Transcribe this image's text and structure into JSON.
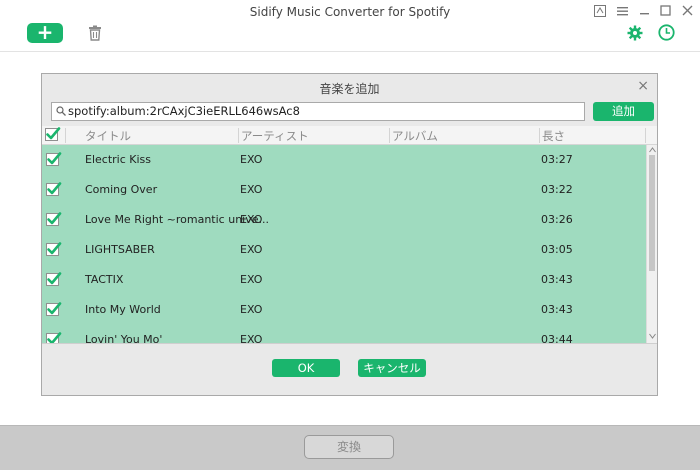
{
  "app": {
    "title": "Sidify Music Converter for Spotify",
    "add_button": "+",
    "convert_label": "変換"
  },
  "dialog": {
    "title": "音楽を追加",
    "close": "×",
    "url_value": "spotify:album:2rCAxjC3ieERLL646wsAc8",
    "add_label": "追加",
    "ok_label": "OK",
    "cancel_label": "キャンセル",
    "columns": {
      "title": "タイトル",
      "artist": "アーティスト",
      "album": "アルバム",
      "length": "長さ"
    },
    "tracks": [
      {
        "title": "Electric Kiss",
        "artist": "EXO",
        "album": "",
        "length": "03:27",
        "checked": true
      },
      {
        "title": "Coming Over",
        "artist": "EXO",
        "album": "",
        "length": "03:22",
        "checked": true
      },
      {
        "title": "Love Me Right ~romantic unive...",
        "artist": "EXO",
        "album": "",
        "length": "03:26",
        "checked": true
      },
      {
        "title": "LIGHTSABER",
        "artist": "EXO",
        "album": "",
        "length": "03:05",
        "checked": true
      },
      {
        "title": "TACTIX",
        "artist": "EXO",
        "album": "",
        "length": "03:43",
        "checked": true
      },
      {
        "title": "Into My World",
        "artist": "EXO",
        "album": "",
        "length": "03:43",
        "checked": true
      },
      {
        "title": "Lovin' You Mo'",
        "artist": "EXO",
        "album": "",
        "length": "03:44",
        "checked": true
      }
    ]
  },
  "colors": {
    "accent": "#1ab56d",
    "row_highlight": "#9fdbbf",
    "dialog_bg": "#e9e9e9",
    "bottom_bar": "#c9c9c9"
  },
  "icons": [
    "add-icon",
    "trash-icon",
    "gear-icon",
    "clock-icon",
    "search-icon",
    "close-icon",
    "checkbox-checked-icon"
  ]
}
